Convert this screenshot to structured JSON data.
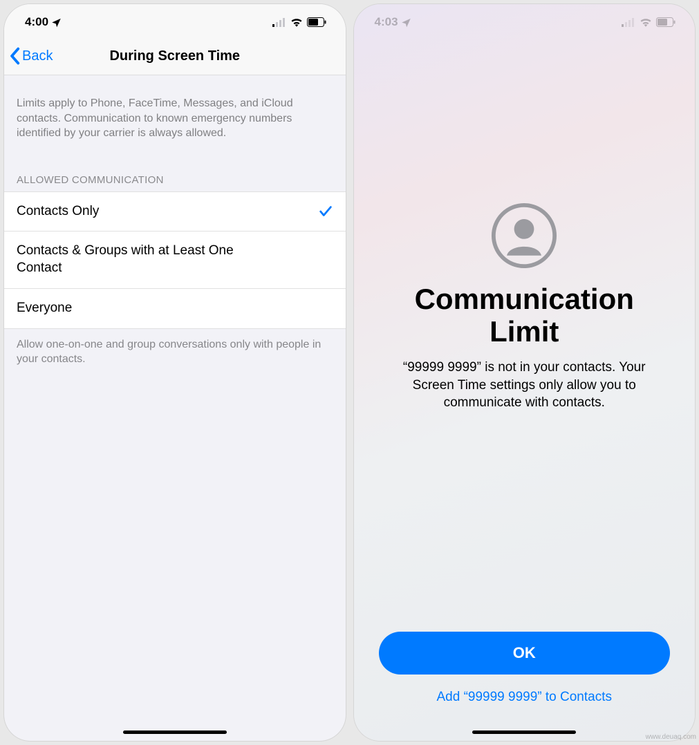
{
  "left": {
    "status": {
      "time": "4:00"
    },
    "nav": {
      "back": "Back",
      "title": "During Screen Time"
    },
    "intro": "Limits apply to Phone, FaceTime, Messages, and iCloud contacts. Communication to known emergency numbers identified by your carrier is always allowed.",
    "section_header": "ALLOWED COMMUNICATION",
    "options": [
      {
        "label": "Contacts Only",
        "selected": true
      },
      {
        "label": "Contacts & Groups with at Least One Contact",
        "selected": false
      },
      {
        "label": "Everyone",
        "selected": false
      }
    ],
    "footer": "Allow one-on-one and group conversations only with people in your contacts."
  },
  "right": {
    "status": {
      "time": "4:03"
    },
    "title": "Communication Limit",
    "description": "“99999 9999” is not in your contacts. Your Screen Time settings only allow you to communicate with contacts.",
    "ok_label": "OK",
    "add_link": "Add “99999 9999” to Contacts"
  },
  "watermark": "www.deuaq.com"
}
